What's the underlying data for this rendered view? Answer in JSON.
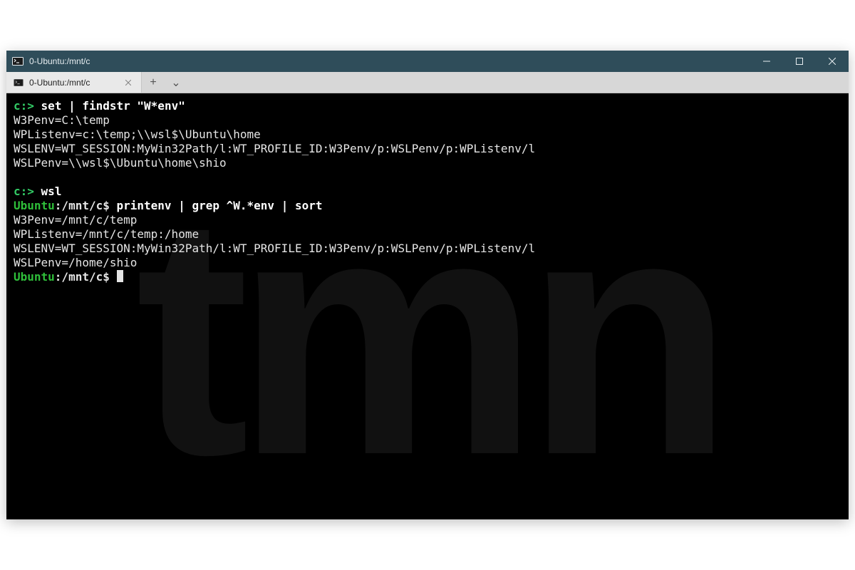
{
  "window": {
    "title": "0-Ubuntu:/mnt/c"
  },
  "tabs": {
    "items": [
      {
        "title": "0-Ubuntu:/mnt/c"
      }
    ],
    "new_tab_glyph": "+",
    "menu_glyph": "⌄"
  },
  "watermark": {
    "text": "tmn"
  },
  "terminal": {
    "lines": [
      {
        "type": "dos-prompt",
        "prompt": "c:>",
        "command": "set | findstr \"W*env\""
      },
      {
        "type": "out",
        "text": "W3Penv=C:\\temp"
      },
      {
        "type": "out",
        "text": "WPListenv=c:\\temp;\\\\wsl$\\Ubuntu\\home"
      },
      {
        "type": "out",
        "text": "WSLENV=WT_SESSION:MyWin32Path/l:WT_PROFILE_ID:W3Penv/p:WSLPenv/p:WPListenv/l"
      },
      {
        "type": "out",
        "text": "WSLPenv=\\\\wsl$\\Ubuntu\\home\\shio"
      },
      {
        "type": "blank"
      },
      {
        "type": "dos-prompt",
        "prompt": "c:>",
        "command": "wsl"
      },
      {
        "type": "bash-prompt",
        "host": "Ubuntu",
        "path": ":/mnt/c$",
        "command": "printenv | grep ^W.*env | sort"
      },
      {
        "type": "out",
        "text": "W3Penv=/mnt/c/temp"
      },
      {
        "type": "out",
        "text": "WPListenv=/mnt/c/temp:/home"
      },
      {
        "type": "out",
        "text": "WSLENV=WT_SESSION:MyWin32Path/l:WT_PROFILE_ID:W3Penv/p:WSLPenv/p:WPListenv/l"
      },
      {
        "type": "out",
        "text": "WSLPenv=/home/shio"
      },
      {
        "type": "bash-prompt",
        "host": "Ubuntu",
        "path": ":/mnt/c$",
        "command": "",
        "cursor": true
      }
    ]
  }
}
